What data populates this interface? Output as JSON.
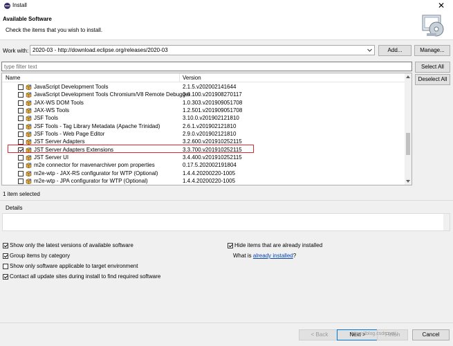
{
  "window": {
    "title": "Install",
    "close_glyph": "✕"
  },
  "header": {
    "title": "Available Software",
    "description": "Check the items that you wish to install."
  },
  "work_with": {
    "label": "Work with:",
    "value": "2020-03 - http://download.eclipse.org/releases/2020-03",
    "add_label": "Add...",
    "manage_label": "Manage..."
  },
  "filter": {
    "placeholder": "type filter text"
  },
  "buttons": {
    "select_all": "Select All",
    "deselect_all": "Deselect All"
  },
  "tree": {
    "columns": {
      "name": "Name",
      "version": "Version"
    },
    "rows": [
      {
        "name": "JavaScript Development Tools",
        "version": "2.1.5.v202002141644",
        "checked": false
      },
      {
        "name": "JavaScript Development Tools Chromium/V8 Remote Debugger",
        "version": "0.6.100.v201908270117",
        "checked": false
      },
      {
        "name": "JAX-WS DOM Tools",
        "version": "1.0.303.v201909051708",
        "checked": false
      },
      {
        "name": "JAX-WS Tools",
        "version": "1.2.501.v201909051708",
        "checked": false
      },
      {
        "name": "JSF Tools",
        "version": "3.10.0.v201902121810",
        "checked": false
      },
      {
        "name": "JSF Tools - Tag Library Metadata (Apache Trinidad)",
        "version": "2.6.1.v201902121810",
        "checked": false
      },
      {
        "name": "JSF Tools - Web Page Editor",
        "version": "2.9.0.v201902121810",
        "checked": false
      },
      {
        "name": "JST Server Adapters",
        "version": "3.2.600.v201910252115",
        "checked": false
      },
      {
        "name": "JST Server Adapters Extensions",
        "version": "3.3.700.v201910252115",
        "checked": true
      },
      {
        "name": "JST Server UI",
        "version": "3.4.400.v201910252115",
        "checked": false
      },
      {
        "name": "m2e connector for mavenarchiver pom properties",
        "version": "0.17.5.202002191804",
        "checked": false
      },
      {
        "name": "m2e-wtp - JAX-RS configurator for WTP (Optional)",
        "version": "1.4.4.20200220-1005",
        "checked": false
      },
      {
        "name": "m2e-wtp - JPA configurator for WTP (Optional)",
        "version": "1.4.4.20200220-1005",
        "checked": false
      }
    ]
  },
  "status": {
    "selected_count": "1 item selected"
  },
  "details": {
    "label": "Details"
  },
  "options": {
    "latest_versions": {
      "label": "Show only the latest versions of available software",
      "checked": true
    },
    "group_by_category": {
      "label": "Group items by category",
      "checked": true
    },
    "target_env": {
      "label": "Show only software applicable to target environment",
      "checked": false
    },
    "contact_sites": {
      "label": "Contact all update sites during install to find required software",
      "checked": true
    },
    "hide_installed": {
      "label": "Hide items that are already installed",
      "checked": true
    },
    "what_is_prefix": "What is ",
    "what_is_link": "already installed",
    "what_is_suffix": "?"
  },
  "footer": {
    "back_label": "< Back",
    "next_label": "Next >",
    "finish_label": "Finish",
    "cancel_label": "Cancel",
    "watermark": "https://blog.csdn.net/..."
  }
}
